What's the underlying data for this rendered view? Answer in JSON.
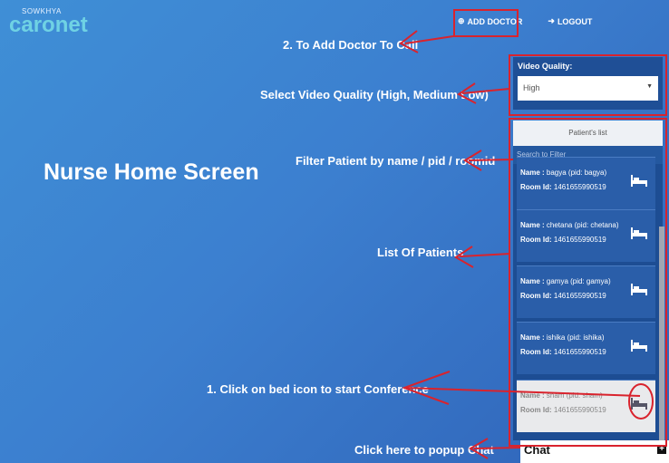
{
  "logo": {
    "tagline": "SOWKHYA",
    "name": "caronet"
  },
  "nav": {
    "add_doctor": "ADD DOCTOR",
    "logout": "LOGOUT"
  },
  "annotations": {
    "add_doctor": "2. To Add Doctor To Call",
    "video_quality": "Select Video Quality (High, Medium Low)",
    "filter": "Filter Patient by name / pid / roomid",
    "list": "List Of Patients",
    "bed_click": "1. Click on bed icon to start Conference",
    "chat": "Click here to popup Chat"
  },
  "page_title": "Nurse Home Screen",
  "video_quality": {
    "label": "Video Quality:",
    "selected": "High"
  },
  "patients_panel": {
    "header": "Patient's list",
    "filter_placeholder": "Search to Filter",
    "items": [
      {
        "name": "bagya (pid: bagya)",
        "room": "1461655990519"
      },
      {
        "name": "chetana (pid: chetana)",
        "room": "1461655990519"
      },
      {
        "name": "gamya (pid: gamya)",
        "room": "1461655990519"
      },
      {
        "name": "ishika (pid: ishika)",
        "room": "1461655990519"
      },
      {
        "name": "sham (pid: sham)",
        "room": "1461655990519"
      }
    ],
    "name_label": "Name : ",
    "room_label": "Room Id: "
  },
  "chat": {
    "label": "Chat"
  },
  "colors": {
    "annotation_red": "#d9232d",
    "panel": "#1d4d93",
    "accent": "#6fd2e4"
  }
}
